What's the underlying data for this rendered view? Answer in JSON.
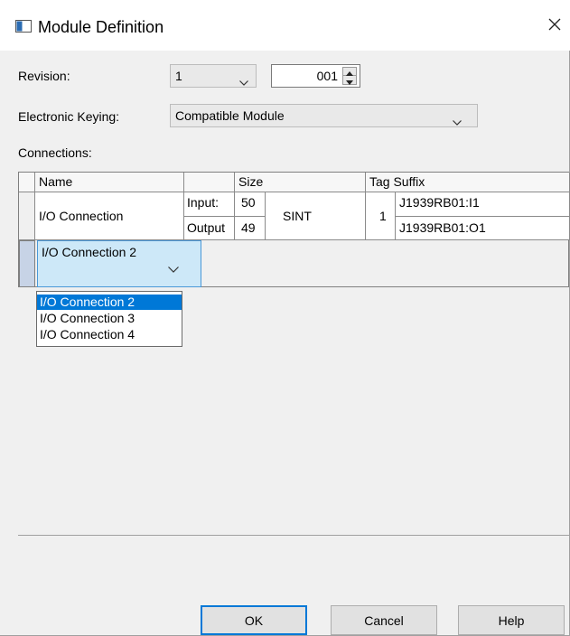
{
  "window": {
    "title": "Module Definition",
    "icons": {
      "app": "module-window-icon",
      "close": "close-icon"
    }
  },
  "revision": {
    "label": "Revision:",
    "major_value": "1",
    "minor_value": "001"
  },
  "keying": {
    "label": "Electronic Keying:",
    "value": "Compatible Module"
  },
  "connections": {
    "label": "Connections:",
    "headers": {
      "name": "Name",
      "size": "Size",
      "tag_suffix": "Tag Suffix"
    },
    "rows": [
      {
        "name": "I/O Connection",
        "input_label": "Input:",
        "output_label": "Output",
        "input_size": "50",
        "output_size": "49",
        "data_type": "SINT",
        "instances": "1",
        "input_tag": "J1939RB01:I1",
        "output_tag": "J1939RB01:O1"
      }
    ],
    "editing_row": {
      "name": "I/O Connection 2"
    },
    "dropdown_options": [
      "I/O Connection 2",
      "I/O Connection 3",
      "I/O Connection 4"
    ],
    "dropdown_selected_index": 0
  },
  "buttons": {
    "ok": "OK",
    "cancel": "Cancel",
    "help": "Help"
  },
  "colors": {
    "dialog_bg": "#f0f0f0",
    "selection": "#0078d7",
    "edit_cell": "#cde8f8"
  }
}
